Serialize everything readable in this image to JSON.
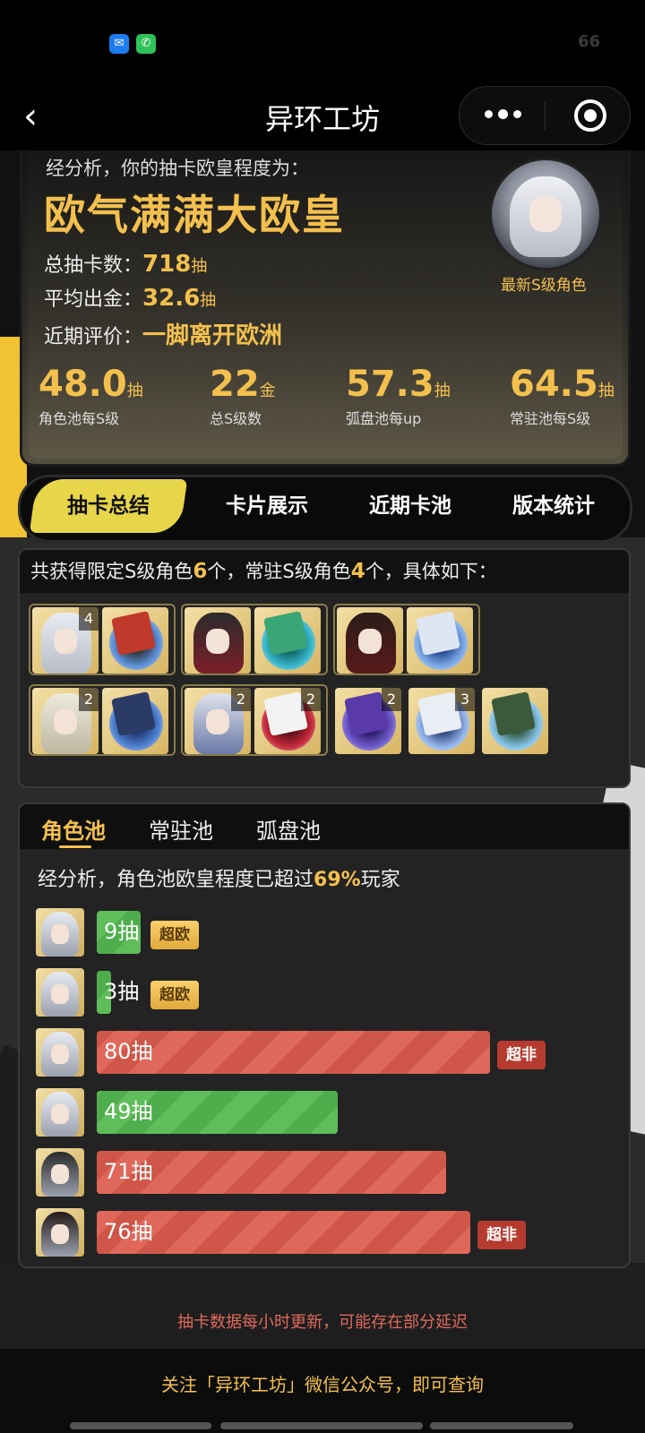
{
  "status_bar": {
    "battery": "66",
    "icons": [
      "notification-app-icon",
      "phone-icon"
    ],
    "icon_colors": [
      "#1e7cf0",
      "#2ec25b"
    ]
  },
  "nav": {
    "title": "异环工坊"
  },
  "summary": {
    "intro": "经分析，你的抽卡欧皇程度为：",
    "level": "欧气满满大欧皇",
    "rows": [
      {
        "label": "总抽卡数：",
        "value": "718",
        "unit": "抽"
      },
      {
        "label": "平均出金：",
        "value": "32.6",
        "unit": "抽"
      },
      {
        "label": "近期评价：",
        "value": "一脚离开欧洲",
        "unit": ""
      }
    ],
    "latest_label": "最新S级角色",
    "stats": [
      {
        "num": "48.0",
        "unit": "抽",
        "label": "角色池每S级"
      },
      {
        "num": "22",
        "unit": "金",
        "label": "总S级数"
      },
      {
        "num": "57.3",
        "unit": "抽",
        "label": "弧盘池每up"
      },
      {
        "num": "64.5",
        "unit": "抽",
        "label": "常驻池每S级"
      }
    ]
  },
  "tabs": [
    "抽卡总结",
    "卡片展示",
    "近期卡池",
    "版本统计"
  ],
  "obtained": {
    "h1": "共获得限定S级角色",
    "limited": "6",
    "h2": "个，常驻S级角色",
    "standard": "4",
    "h3": "个，具体如下：",
    "counts": [
      "4",
      "2",
      "2",
      "2",
      "2",
      "3"
    ]
  },
  "pool": {
    "tabs": [
      "角色池",
      "常驻池",
      "弧盘池"
    ],
    "analysis_prefix": "经分析，角色池欧皇程度已超过",
    "analysis_pct": "69%",
    "analysis_suffix": "玩家",
    "rows": [
      {
        "label": "9抽",
        "pulls": 9,
        "color": "green",
        "badge": "超欧"
      },
      {
        "label": "3抽",
        "pulls": 3,
        "color": "green",
        "badge": "超欧"
      },
      {
        "label": "80抽",
        "pulls": 80,
        "color": "red",
        "badge": "超非"
      },
      {
        "label": "49抽",
        "pulls": 49,
        "color": "green",
        "badge": ""
      },
      {
        "label": "71抽",
        "pulls": 71,
        "color": "red",
        "badge": ""
      },
      {
        "label": "76抽",
        "pulls": 76,
        "color": "red",
        "badge": "超非"
      }
    ]
  },
  "footnote": "抽卡数据每小时更新，可能存在部分延迟",
  "bottom": "关注「异环工坊」微信公众号，即可查询"
}
